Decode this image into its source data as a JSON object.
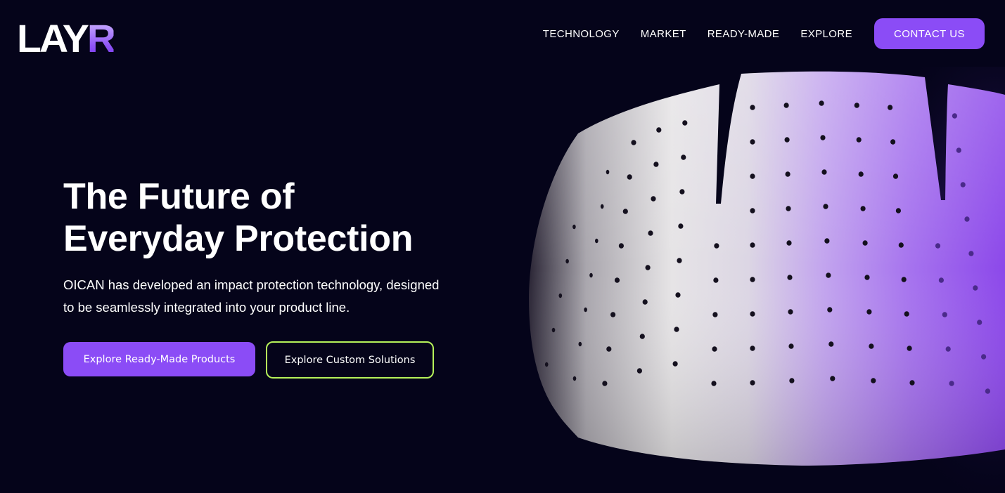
{
  "brand": {
    "logo_main": "LAY",
    "logo_accent": "R",
    "accent_color": "#8b4cf6",
    "outline_color": "#b6f25a",
    "background": "#05041a"
  },
  "nav": {
    "items": [
      {
        "label": "TECHNOLOGY"
      },
      {
        "label": "MARKET"
      },
      {
        "label": "READY-MADE"
      },
      {
        "label": "EXPLORE"
      }
    ],
    "contact_label": "CONTACT US"
  },
  "hero": {
    "title_line1": "The Future of",
    "title_line2": "Everyday Protection",
    "subtitle_line1": "OICAN has developed an impact protection technology, designed",
    "subtitle_line2": "to be seamlessly integrated into your product line.",
    "primary_cta": "Explore Ready-Made Products",
    "secondary_cta": "Explore Custom Solutions"
  },
  "image": {
    "subject": "perforated protective helmet liner",
    "icon": "helmet-liner-image"
  }
}
